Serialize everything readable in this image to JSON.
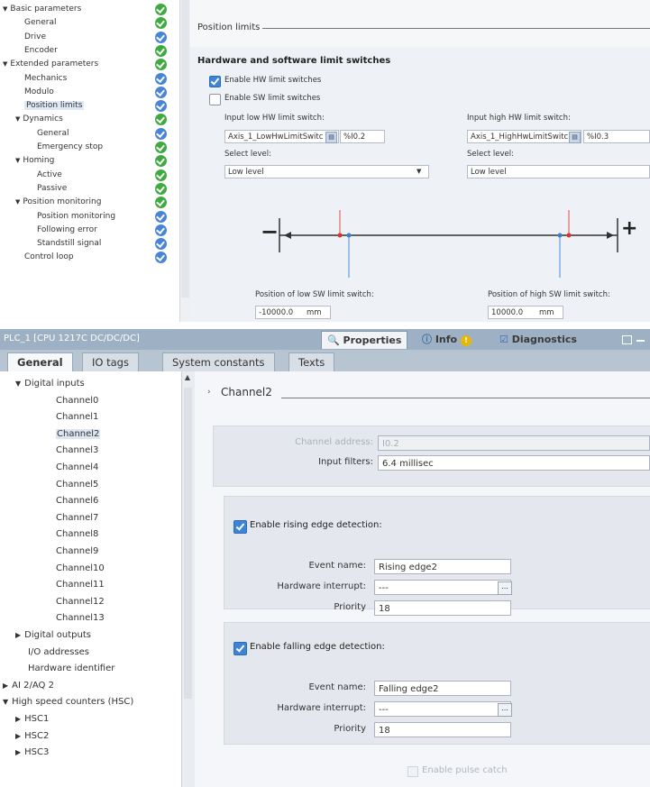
{
  "top": {
    "tree": [
      {
        "label": "Basic parameters",
        "expanded": true,
        "status": "green"
      },
      {
        "label": "General",
        "status": "green"
      },
      {
        "label": "Drive",
        "status": "blue"
      },
      {
        "label": "Encoder",
        "status": "green"
      },
      {
        "label": "Extended parameters",
        "expanded": true,
        "status": "green"
      },
      {
        "label": "Mechanics",
        "status": "blue"
      },
      {
        "label": "Modulo",
        "status": "blue"
      },
      {
        "label": "Position limits",
        "status": "blue",
        "selected": true
      },
      {
        "label": "Dynamics",
        "expanded": true,
        "status": "green"
      },
      {
        "label": "General",
        "status": "blue"
      },
      {
        "label": "Emergency stop",
        "status": "green"
      },
      {
        "label": "Homing",
        "expanded": true,
        "status": "green"
      },
      {
        "label": "Active",
        "status": "green"
      },
      {
        "label": "Passive",
        "status": "green"
      },
      {
        "label": "Position monitoring",
        "expanded": true,
        "status": "green"
      },
      {
        "label": "Position monitoring",
        "status": "blue"
      },
      {
        "label": "Following error",
        "status": "blue"
      },
      {
        "label": "Standstill signal",
        "status": "blue"
      },
      {
        "label": "Control loop",
        "status": "blue"
      }
    ],
    "section_title": "Position limits",
    "hw_sw_title": "Hardware and software limit switches",
    "enable_hw": {
      "label": "Enable HW limit switches",
      "checked": true
    },
    "enable_sw": {
      "label": "Enable SW limit switches",
      "checked": false
    },
    "low_hw": {
      "label": "Input low HW limit switch:",
      "value": "Axis_1_LowHwLimitSwitc",
      "address": "%I0.2"
    },
    "high_hw": {
      "label": "Input high HW limit switch:",
      "value": "Axis_1_HighHwLimitSwitc",
      "address": "%I0.3"
    },
    "select_level_label": "Select level:",
    "low_level": "Low level",
    "high_level": "Low level",
    "low_sw": {
      "label": "Position of low SW limit switch:",
      "value": "-10000.0",
      "unit": "mm"
    },
    "high_sw": {
      "label": "Position of high SW limit switch:",
      "value": "10000.0",
      "unit": "mm"
    },
    "minus": "−",
    "plus": "+"
  },
  "bottom": {
    "window_title": "PLC_1 [CPU 1217C DC/DC/DC]",
    "inspector_tabs": [
      {
        "label": "Properties",
        "icon": "properties-icon",
        "active": true
      },
      {
        "label": "Info",
        "icon": "info-icon"
      },
      {
        "label": "Diagnostics",
        "icon": "diagnostics-icon"
      }
    ],
    "property_tabs": [
      "General",
      "IO tags",
      "System constants",
      "Texts"
    ],
    "tree": [
      {
        "label": "Digital inputs",
        "expanded": true,
        "level": 1
      },
      {
        "label": "Channel0",
        "level": 2
      },
      {
        "label": "Channel1",
        "level": 2
      },
      {
        "label": "Channel2",
        "level": 2,
        "selected": true
      },
      {
        "label": "Channel3",
        "level": 2
      },
      {
        "label": "Channel4",
        "level": 2
      },
      {
        "label": "Channel5",
        "level": 2
      },
      {
        "label": "Channel6",
        "level": 2
      },
      {
        "label": "Channel7",
        "level": 2
      },
      {
        "label": "Channel8",
        "level": 2
      },
      {
        "label": "Channel9",
        "level": 2
      },
      {
        "label": "Channel10",
        "level": 2
      },
      {
        "label": "Channel11",
        "level": 2
      },
      {
        "label": "Channel12",
        "level": 2
      },
      {
        "label": "Channel13",
        "level": 2
      },
      {
        "label": "Digital outputs",
        "collapsed": true,
        "level": 1
      },
      {
        "label": "I/O addresses",
        "level": 1.5
      },
      {
        "label": "Hardware identifier",
        "level": 1.5
      },
      {
        "label": "AI 2/AQ 2",
        "collapsed": true,
        "level": 0
      },
      {
        "label": "High speed counters (HSC)",
        "expanded": true,
        "level": 0
      },
      {
        "label": "HSC1",
        "collapsed": true,
        "level": 1
      },
      {
        "label": "HSC2",
        "collapsed": true,
        "level": 1
      },
      {
        "label": "HSC3",
        "collapsed": true,
        "level": 1
      }
    ],
    "channel_title": "Channel2",
    "channel_address_label": "Channel address:",
    "channel_address": "I0.2",
    "input_filters_label": "Input filters:",
    "input_filters": "6.4 millisec",
    "rising": {
      "checkbox_label": "Enable rising edge detection:",
      "event_name_label": "Event name:",
      "event_name": "Rising edge2",
      "hw_interrupt_label": "Hardware interrupt:",
      "hw_interrupt": "---",
      "priority_label": "Priority",
      "priority": "18"
    },
    "falling": {
      "checkbox_label": "Enable falling edge detection:",
      "event_name_label": "Event name:",
      "event_name": "Falling edge2",
      "hw_interrupt_label": "Hardware interrupt:",
      "hw_interrupt": "---",
      "priority_label": "Priority",
      "priority": "18"
    },
    "pulse_catch": "Enable pulse catch"
  }
}
